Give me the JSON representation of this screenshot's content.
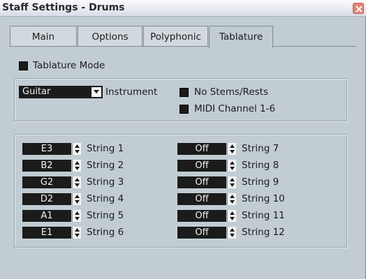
{
  "window": {
    "title": "Staff Settings - Drums"
  },
  "tabs": [
    {
      "label": "Main"
    },
    {
      "label": "Options"
    },
    {
      "label": "Polyphonic"
    },
    {
      "label": "Tablature",
      "active": true
    }
  ],
  "tablature_mode": {
    "label": "Tablature Mode",
    "checked": true
  },
  "instrument": {
    "selected": "Guitar",
    "label": "Instrument"
  },
  "options": {
    "no_stems": {
      "label": "No Stems/Rests",
      "checked": true
    },
    "midi_channel": {
      "label": "MIDI Channel 1-6",
      "checked": true
    }
  },
  "strings_left": [
    {
      "value": "E3",
      "label": "String 1"
    },
    {
      "value": "B2",
      "label": "String 2"
    },
    {
      "value": "G2",
      "label": "String 3"
    },
    {
      "value": "D2",
      "label": "String 4"
    },
    {
      "value": "A1",
      "label": "String 5"
    },
    {
      "value": "E1",
      "label": "String 6"
    }
  ],
  "strings_right": [
    {
      "value": "Off",
      "label": "String 7"
    },
    {
      "value": "Off",
      "label": "String 8"
    },
    {
      "value": "Off",
      "label": "String 9"
    },
    {
      "value": "Off",
      "label": "String 10"
    },
    {
      "value": "Off",
      "label": "String 11"
    },
    {
      "value": "Off",
      "label": "String 12"
    }
  ],
  "colors": {
    "panel": "#c1ccd3",
    "field": "#1b1b1b",
    "close": "#e08474"
  }
}
